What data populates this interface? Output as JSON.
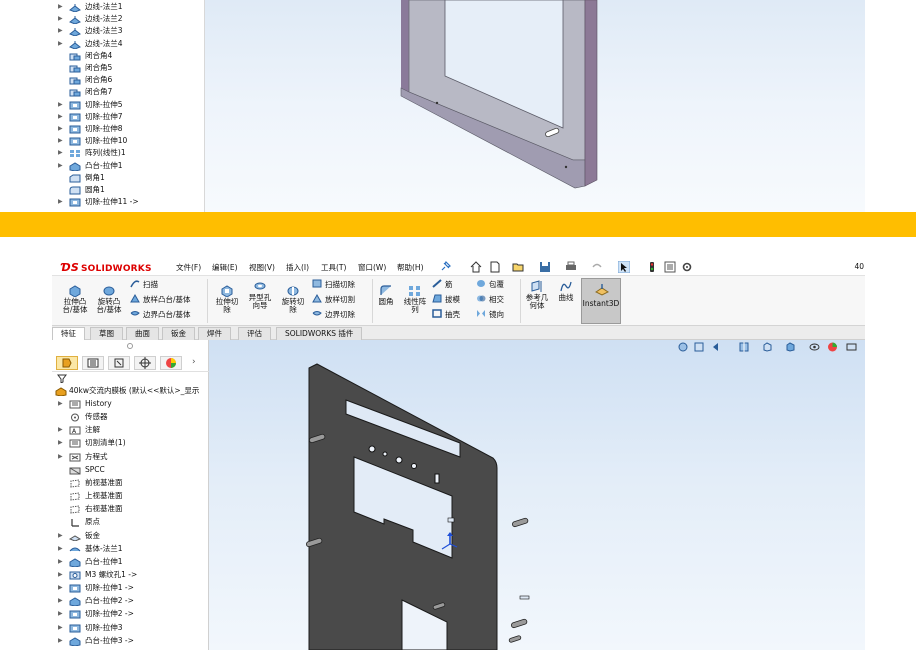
{
  "top": {
    "tree": [
      {
        "label": "边线-法兰1",
        "icon": "flange-icon",
        "arrow": true
      },
      {
        "label": "边线-法兰2",
        "icon": "flange-icon",
        "arrow": true
      },
      {
        "label": "边线-法兰3",
        "icon": "flange-icon",
        "arrow": true
      },
      {
        "label": "边线-法兰4",
        "icon": "flange-icon",
        "arrow": true
      },
      {
        "label": "闭合角4",
        "icon": "closed-corner-icon",
        "arrow": false
      },
      {
        "label": "闭合角5",
        "icon": "closed-corner-icon",
        "arrow": false
      },
      {
        "label": "闭合角6",
        "icon": "closed-corner-icon",
        "arrow": false
      },
      {
        "label": "闭合角7",
        "icon": "closed-corner-icon",
        "arrow": false
      },
      {
        "label": "切除-拉伸5",
        "icon": "cut-extrude-icon",
        "arrow": true
      },
      {
        "label": "切除-拉伸7",
        "icon": "cut-extrude-icon",
        "arrow": true
      },
      {
        "label": "切除-拉伸8",
        "icon": "cut-extrude-icon",
        "arrow": true
      },
      {
        "label": "切除-拉伸10",
        "icon": "cut-extrude-icon",
        "arrow": true
      },
      {
        "label": "阵列(线性)1",
        "icon": "linear-pattern-icon",
        "arrow": true
      },
      {
        "label": "凸台-拉伸1",
        "icon": "boss-extrude-icon",
        "arrow": true
      },
      {
        "label": "倒角1",
        "icon": "chamfer-icon",
        "arrow": false
      },
      {
        "label": "圆角1",
        "icon": "fillet-icon",
        "arrow": false
      },
      {
        "label": "切除-拉伸11 ->",
        "icon": "cut-extrude-icon",
        "arrow": true
      }
    ]
  },
  "app": {
    "logo": "SOLIDWORKS",
    "menus": [
      "文件(F)",
      "编辑(E)",
      "视图(V)",
      "插入(I)",
      "工具(T)",
      "窗口(W)",
      "帮助(H)"
    ],
    "right_count": "40"
  },
  "ribbon": {
    "extrude_boss": "拉伸凸\n台/基体",
    "revolve_boss": "旋转凸\n台/基体",
    "sweep": "扫描",
    "loft": "放样凸台/基体",
    "boundary": "边界凸台/基体",
    "extrude_cut": "拉伸切\n除",
    "hole_wizard": "异型孔\n向导",
    "revolve_cut": "旋转切\n除",
    "sweep_cut": "扫描切除",
    "loft_cut": "放样切割",
    "boundary_cut": "边界切除",
    "fillet": "圆角",
    "linear_pattern": "线性阵\n列",
    "rib": "筋",
    "draft": "拔模",
    "shell": "抽壳",
    "wrap": "包覆",
    "intersect": "相交",
    "mirror": "镜向",
    "ref_geometry": "参考几\n何体",
    "curves": "曲线",
    "instant3d": "Instant3D"
  },
  "tabs": [
    {
      "label": "特征",
      "active": true
    },
    {
      "label": "草图",
      "active": false
    },
    {
      "label": "曲面",
      "active": false
    },
    {
      "label": "钣金",
      "active": false
    },
    {
      "label": "焊件",
      "active": false
    },
    {
      "label": "评估",
      "active": false
    },
    {
      "label": "SOLIDWORKS 插件",
      "active": false
    }
  ],
  "tree": {
    "root": "40kw交流内膜板 (默认<<默认>_显示",
    "items": [
      {
        "label": "History",
        "icon": "history-icon",
        "arrow": true
      },
      {
        "label": "传感器",
        "icon": "sensor-icon",
        "arrow": false
      },
      {
        "label": "注解",
        "icon": "annotation-icon",
        "arrow": true
      },
      {
        "label": "切割清单(1)",
        "icon": "cut-list-icon",
        "arrow": true
      },
      {
        "label": "方程式",
        "icon": "equation-icon",
        "arrow": true
      },
      {
        "label": "SPCC",
        "icon": "material-icon",
        "arrow": false
      },
      {
        "label": "前视基准面",
        "icon": "plane-icon",
        "arrow": false
      },
      {
        "label": "上视基准面",
        "icon": "plane-icon",
        "arrow": false
      },
      {
        "label": "右视基准面",
        "icon": "plane-icon",
        "arrow": false
      },
      {
        "label": "原点",
        "icon": "origin-icon",
        "arrow": false
      },
      {
        "label": "钣金",
        "icon": "sheet-metal-icon",
        "arrow": true
      },
      {
        "label": "基体-法兰1",
        "icon": "base-flange-icon",
        "arrow": true
      },
      {
        "label": "凸台-拉伸1",
        "icon": "boss-extrude-icon",
        "arrow": true
      },
      {
        "label": "M3 螺纹孔1 ->",
        "icon": "hole-icon",
        "arrow": true
      },
      {
        "label": "切除-拉伸1 ->",
        "icon": "cut-extrude-icon",
        "arrow": true
      },
      {
        "label": "凸台-拉伸2 ->",
        "icon": "boss-extrude-icon",
        "arrow": true
      },
      {
        "label": "切除-拉伸2 ->",
        "icon": "cut-extrude-icon",
        "arrow": true
      },
      {
        "label": "切除-拉伸3",
        "icon": "cut-extrude-icon",
        "arrow": true
      },
      {
        "label": "凸台-拉伸3 ->",
        "icon": "boss-extrude-icon",
        "arrow": true
      }
    ]
  },
  "colors": {
    "band": "#ffbe00",
    "accent": "#d00000",
    "part_dark": "#4a4a4a",
    "part_top": "#b9b9c6",
    "part_edge": "#7d6a8c"
  }
}
